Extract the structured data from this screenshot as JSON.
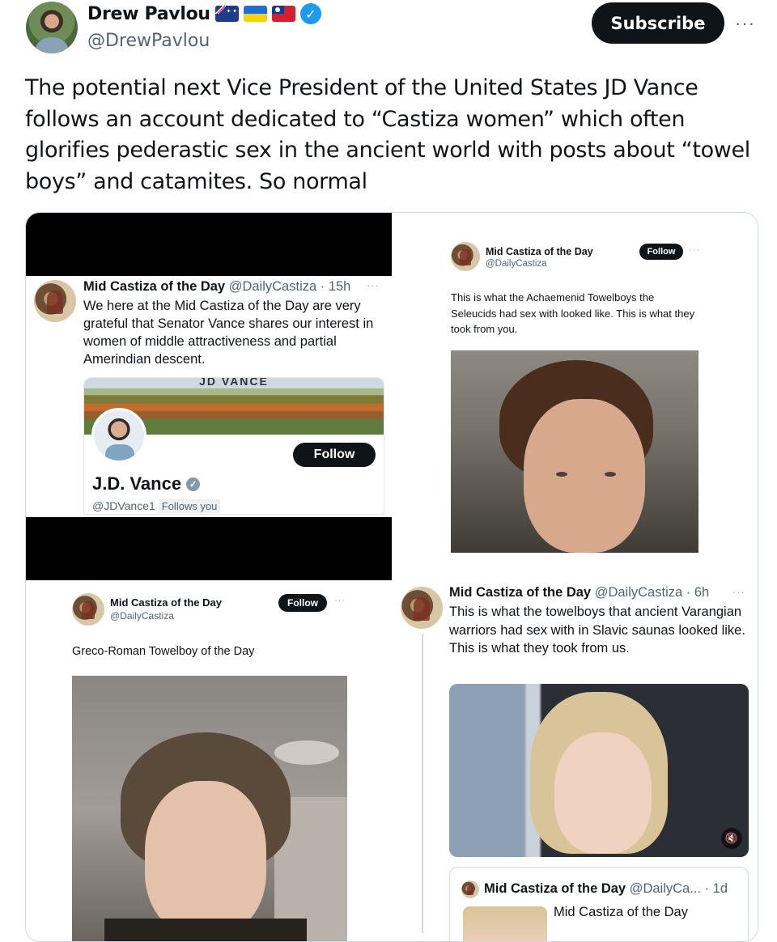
{
  "tweet": {
    "author_name": "Drew Pavlou",
    "handle": "@DrewPavlou",
    "subscribe_label": "Subscribe",
    "more_label": "···",
    "verified_icon": "check-badge-icon",
    "flags": [
      "flag-australia-icon",
      "flag-ukraine-icon",
      "flag-taiwan-icon"
    ],
    "text": "The potential next Vice President of the United States JD Vance follows an account dedicated to “Castiza women” which often glorifies pederastic sex in the ancient world with posts about “towel boys” and catamites. So normal"
  },
  "panel1": {
    "name": "Mid Castiza of the Day",
    "meta": "@DailyCastiza · 15h",
    "dots": "···",
    "body": "We here at the Mid Castiza of the Day are very grateful that Senator Vance shares our interest in women of middle attractiveness and partial Amerindian descent.",
    "card": {
      "banner_text": "JD VANCE",
      "follow_label": "Follow",
      "name": "J.D. Vance",
      "handle": "@JDVance1",
      "follows_you": "Follows you"
    }
  },
  "panel2": {
    "name": "Mid Castiza of the Day",
    "handle": "@DailyCastiza",
    "follow_label": "Follow",
    "dots": "···",
    "body": "This is what the Achaemenid Towelboys the Seleucids had sex with looked like. This is what they took from you."
  },
  "panel3": {
    "name": "Mid Castiza of the Day",
    "handle": "@DailyCastiza",
    "follow_label": "Follow",
    "dots": "···",
    "body": "Greco-Roman Towelboy of the Day"
  },
  "panel4": {
    "name": "Mid Castiza of the Day",
    "meta": "@DailyCastiza · 6h",
    "dots": "···",
    "body": "This is what the towelboys that ancient Varangian warriors had sex with in Slavic saunas looked like. This is what they took from us.",
    "mute_icon": "🔇",
    "quote": {
      "name": "Mid Castiza of the Day",
      "meta": "@DailyCa... · 1d",
      "body": "Mid Castiza of the Day"
    }
  }
}
